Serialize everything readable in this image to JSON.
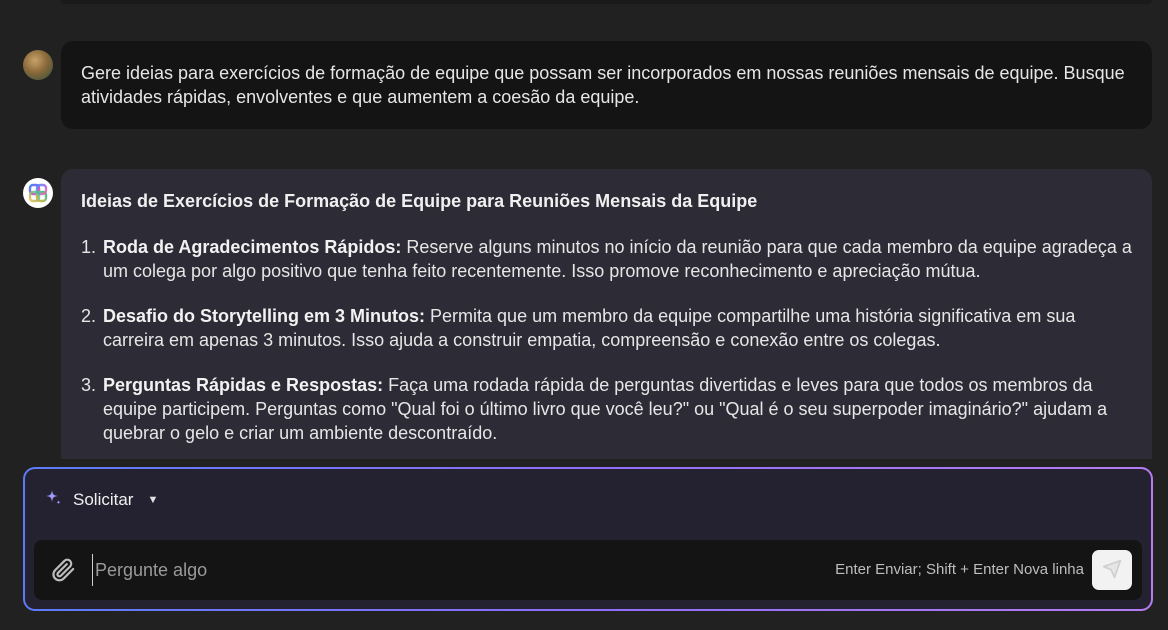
{
  "conversation": {
    "user_message": "Gere ideias para exercícios de formação de equipe que possam ser incorporados em nossas reuniões mensais de equipe. Busque atividades rápidas, envolventes e que aumentem a coesão da equipe.",
    "bot": {
      "heading": "Ideias de Exercícios de Formação de Equipe para Reuniões Mensais da Equipe",
      "items": [
        {
          "number": "1.",
          "title": "Roda de Agradecimentos Rápidos:",
          "text": " Reserve alguns minutos no início da reunião para que cada membro da equipe agradeça a um colega por algo positivo que tenha feito recentemente. Isso promove reconhecimento e apreciação mútua."
        },
        {
          "number": "2.",
          "title": "Desafio do Storytelling em 3 Minutos:",
          "text": " Permita que um membro da equipe compartilhe uma história significativa em sua carreira em apenas 3 minutos. Isso ajuda a construir empatia, compreensão e conexão entre os colegas."
        },
        {
          "number": "3.",
          "title": "Perguntas Rápidas e Respostas:",
          "text": " Faça uma rodada rápida de perguntas divertidas e leves para que todos os membros da equipe participem. Perguntas como \"Qual foi o último livro que você leu?\" ou \"Qual é o seu superpoder imaginário?\" ajudam a quebrar o gelo e criar um ambiente descontraído."
        }
      ]
    }
  },
  "composer": {
    "mode_label": "Solicitar",
    "placeholder": "Pergunte algo",
    "hint": "Enter Enviar; Shift + Enter Nova linha"
  },
  "icons": {
    "mode": "sparkle-icon",
    "mode_caret": "caret-down-icon",
    "attach": "paperclip-icon",
    "send": "send-icon",
    "bot_avatar": "copilot-logo-icon"
  },
  "colors": {
    "background": "#212121",
    "user_bubble": "#141414",
    "bot_bubble": "#2d2c36",
    "composer_border_start": "#5b7cf7",
    "composer_border_end": "#b57cf2"
  }
}
